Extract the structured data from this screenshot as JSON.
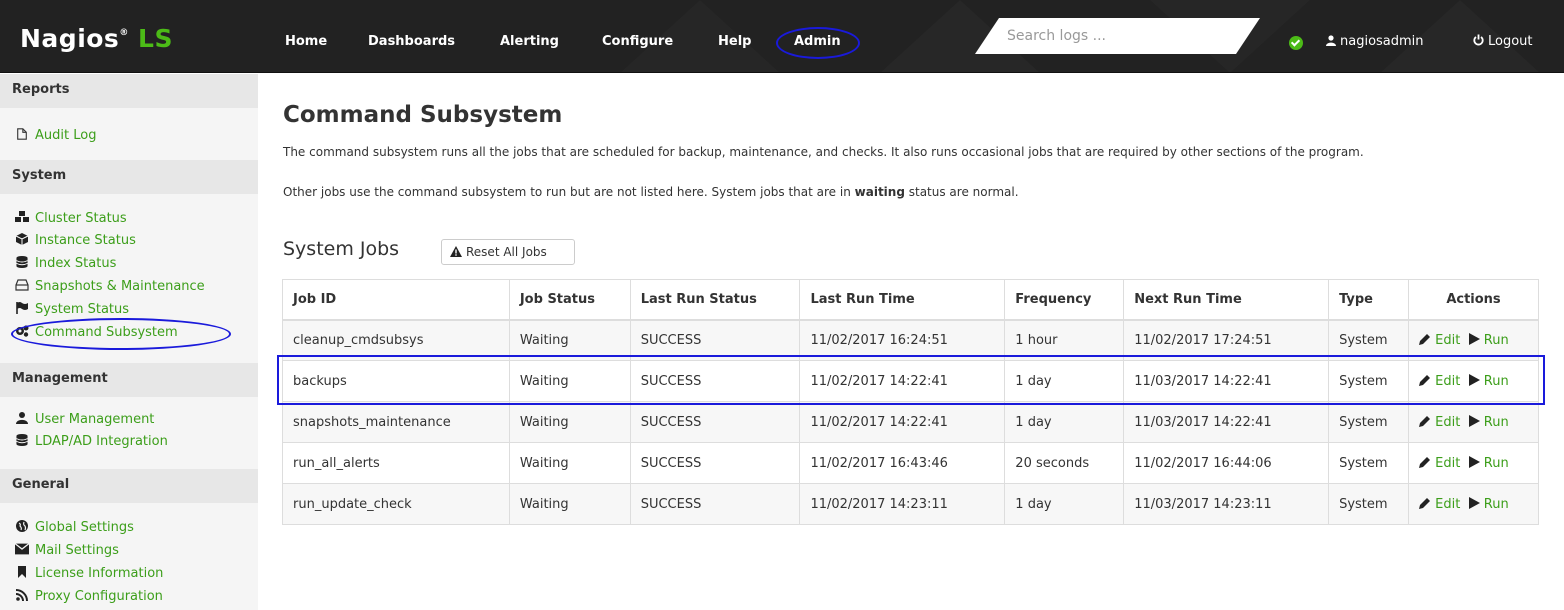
{
  "brand": {
    "name": "Nagios",
    "reg": "®",
    "suffix": "LS"
  },
  "nav": {
    "home": "Home",
    "dashboards": "Dashboards",
    "alerting": "Alerting",
    "configure": "Configure",
    "help": "Help",
    "admin": "Admin"
  },
  "search": {
    "placeholder": "Search logs ..."
  },
  "user": {
    "name": "nagiosadmin",
    "logout": "Logout"
  },
  "sidebar": {
    "reports": {
      "heading": "Reports",
      "items": [
        "Audit Log"
      ]
    },
    "system": {
      "heading": "System",
      "items": [
        "Cluster Status",
        "Instance Status",
        "Index Status",
        "Snapshots & Maintenance",
        "System Status",
        "Command Subsystem"
      ]
    },
    "management": {
      "heading": "Management",
      "items": [
        "User Management",
        "LDAP/AD Integration"
      ]
    },
    "general": {
      "heading": "General",
      "items": [
        "Global Settings",
        "Mail Settings",
        "License Information",
        "Proxy Configuration"
      ]
    }
  },
  "main": {
    "title": "Command Subsystem",
    "desc_line1": "The command subsystem runs all the jobs that are scheduled for backup, maintenance, and checks. It also runs occasional jobs that are required by other sections of the program.",
    "desc_line2_pre": "Other jobs use the command subsystem to run but are not listed here. System jobs that are in ",
    "desc_line2_bold": "waiting",
    "desc_line2_post": " status are normal.",
    "section_title": "System Jobs",
    "reset_label": "Reset All Jobs"
  },
  "table": {
    "headers": [
      "Job ID",
      "Job Status",
      "Last Run Status",
      "Last Run Time",
      "Frequency",
      "Next Run Time",
      "Type",
      "Actions"
    ],
    "edit_label": "Edit",
    "run_label": "Run",
    "rows": [
      [
        "cleanup_cmdsubsys",
        "Waiting",
        "SUCCESS",
        "11/02/2017 16:24:51",
        "1 hour",
        "11/02/2017 17:24:51",
        "System"
      ],
      [
        "backups",
        "Waiting",
        "SUCCESS",
        "11/02/2017 14:22:41",
        "1 day",
        "11/03/2017 14:22:41",
        "System"
      ],
      [
        "snapshots_maintenance",
        "Waiting",
        "SUCCESS",
        "11/02/2017 14:22:41",
        "1 day",
        "11/03/2017 14:22:41",
        "System"
      ],
      [
        "run_all_alerts",
        "Waiting",
        "SUCCESS",
        "11/02/2017 16:43:46",
        "20 seconds",
        "11/02/2017 16:44:06",
        "System"
      ],
      [
        "run_update_check",
        "Waiting",
        "SUCCESS",
        "11/02/2017 14:23:11",
        "1 day",
        "11/03/2017 14:23:11",
        "System"
      ]
    ]
  },
  "colors": {
    "navbar": "#222222",
    "brand_green": "#4cbb17",
    "link_green": "#3c9e1a",
    "annotation_blue": "#1a1adb"
  }
}
